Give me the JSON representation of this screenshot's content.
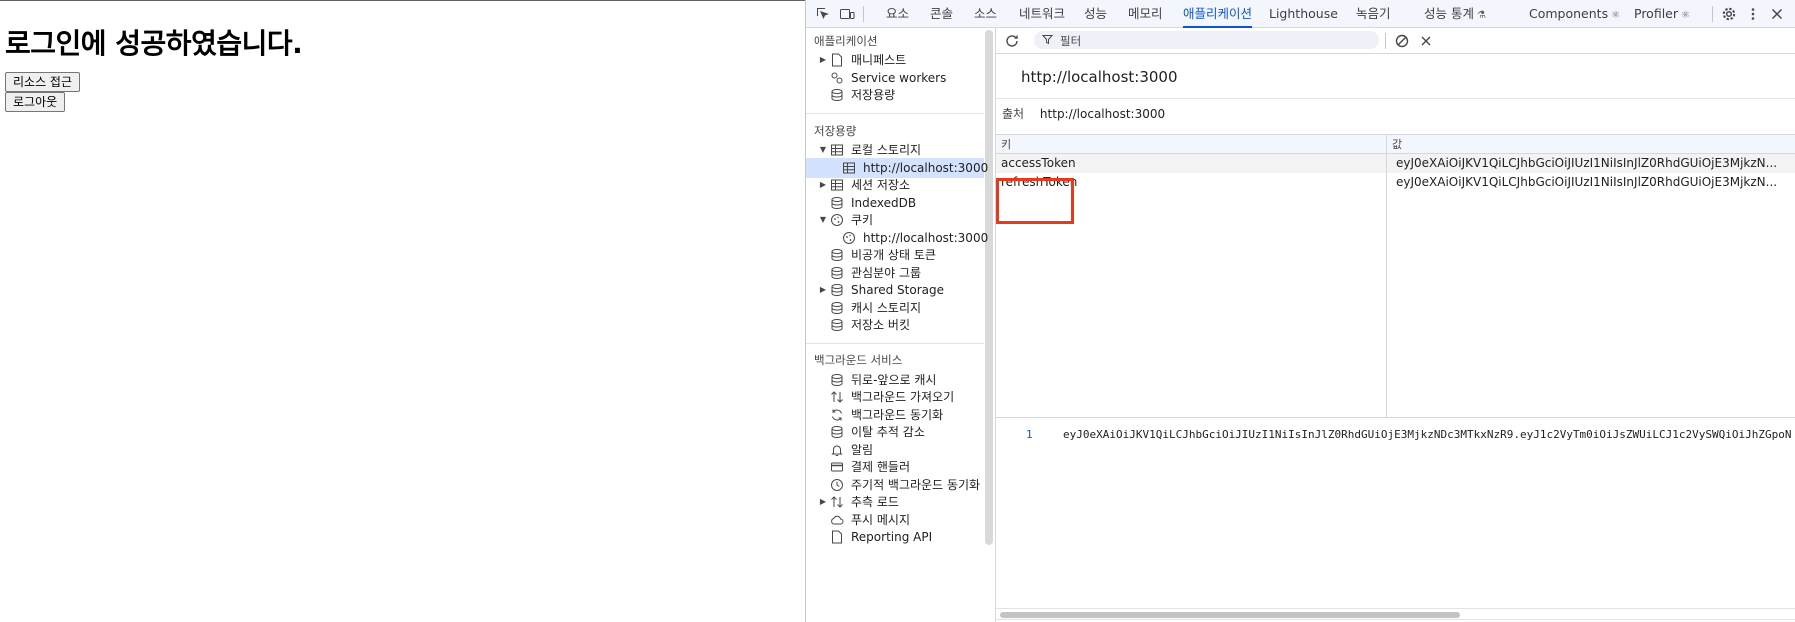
{
  "page": {
    "heading": "로그인에 성공하였습니다.",
    "resource_button": "리소스 접근",
    "logout_button": "로그아웃"
  },
  "devtools": {
    "tabs": [
      "요소",
      "콘솔",
      "소스",
      "네트워크",
      "성능",
      "메모리",
      "애플리케이션",
      "Lighthouse",
      "녹음기",
      "성능 통계",
      "Components",
      "Profiler"
    ],
    "active_tab": "애플리케이션",
    "sidebar": {
      "section_application": "애플리케이션",
      "application_items": [
        "매니페스트",
        "Service workers",
        "저장용량"
      ],
      "section_storage": "저장용량",
      "storage_items": {
        "local_storage": "로컬 스토리지",
        "local_origin": "http://localhost:3000",
        "session_storage": "세션 저장소",
        "indexeddb": "IndexedDB",
        "cookies": "쿠키",
        "cookie_origin": "http://localhost:3000",
        "private_state_tokens": "비공개 상태 토큰",
        "interest_groups": "관심분야 그룹",
        "shared_storage": "Shared Storage",
        "cache_storage": "캐시 스토리지",
        "storage_buckets": "저장소 버킷"
      },
      "section_background": "백그라운드 서비스",
      "background_items": [
        "뒤로-앞으로 캐시",
        "백그라운드 가져오기",
        "백그라운드 동기화",
        "이탈 추적 감소",
        "알림",
        "결제 핸들러",
        "주기적 백그라운드 동기화",
        "추측 로드",
        "푸시 메시지",
        "Reporting API"
      ]
    },
    "main": {
      "filter_placeholder": "필터",
      "origin_title": "http://localhost:3000",
      "origin_label": "출처",
      "origin_value": "http://localhost:3000",
      "table": {
        "col_key": "키",
        "col_value": "값",
        "rows": [
          {
            "key": "accessToken",
            "value": "eyJ0eXAiOiJKV1QiLCJhbGciOiJIUzI1NiIsInJlZ0RhdGUiOjE3MjkzN..."
          },
          {
            "key": "refreshToken",
            "value": "eyJ0eXAiOiJKV1QiLCJhbGciOiJIUzI1NiIsInJlZ0RhdGUiOjE3MjkzN..."
          }
        ]
      },
      "preview_line_number": "1",
      "preview_text": "eyJ0eXAiOiJKV1QiLCJhbGciOiJIUzI1NiIsInJlZ0RhdGUiOjE3MjkzNDc3MTkxNzR9.eyJ1c2VyTm0iOiJsZWUiLCJ1c2VySWQiOiJhZGpoN"
    },
    "colors": {
      "accent": "#0b57d0",
      "highlight_box": "#e53a1e",
      "selected_row": "#d3e3fd"
    }
  }
}
